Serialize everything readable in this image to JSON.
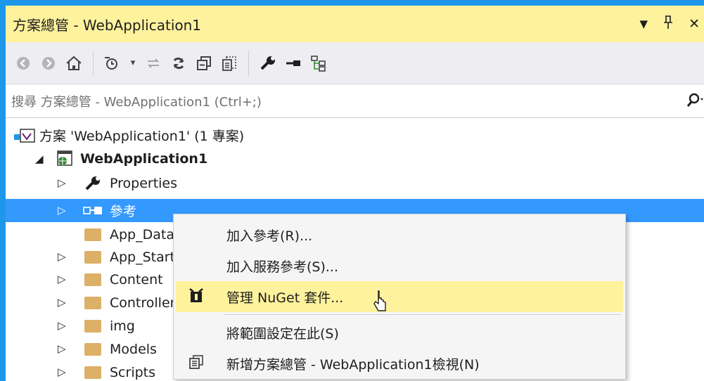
{
  "window": {
    "title": "方案總管 - WebApplication1",
    "controls": [
      "▾",
      "ᵖ",
      "✕"
    ]
  },
  "search": {
    "placeholder": "搜尋 方案總管 - WebApplication1 (Ctrl+;)",
    "icon": "search-icon"
  },
  "tree": {
    "solution": "方案 'WebApplication1' (1 專案)",
    "project": "WebApplication1",
    "items": [
      {
        "label": "Properties"
      },
      {
        "label": "參考"
      },
      {
        "label": "App_Data"
      },
      {
        "label": "App_Start"
      },
      {
        "label": "Content"
      },
      {
        "label": "Controllers"
      },
      {
        "label": "img"
      },
      {
        "label": "Models"
      },
      {
        "label": "Scripts"
      }
    ]
  },
  "context_menu": {
    "items": [
      {
        "label": "加入參考(R)...",
        "mnemonic": "R"
      },
      {
        "label": "加入服務參考(S)...",
        "mnemonic": "S"
      },
      {
        "label": "管理 NuGet 套件...",
        "mnemonic": "N",
        "highlighted": true
      },
      {
        "label": "將範圍設定在此(S)",
        "mnemonic": "S"
      },
      {
        "label": "新增方案總管 - WebApplication1檢視(N)",
        "mnemonic": "N"
      }
    ]
  },
  "colors": {
    "frame": "#1c97ea",
    "title_bg": "#fff29d",
    "selection": "#3399ff",
    "menu_highlight": "#fff29d"
  }
}
